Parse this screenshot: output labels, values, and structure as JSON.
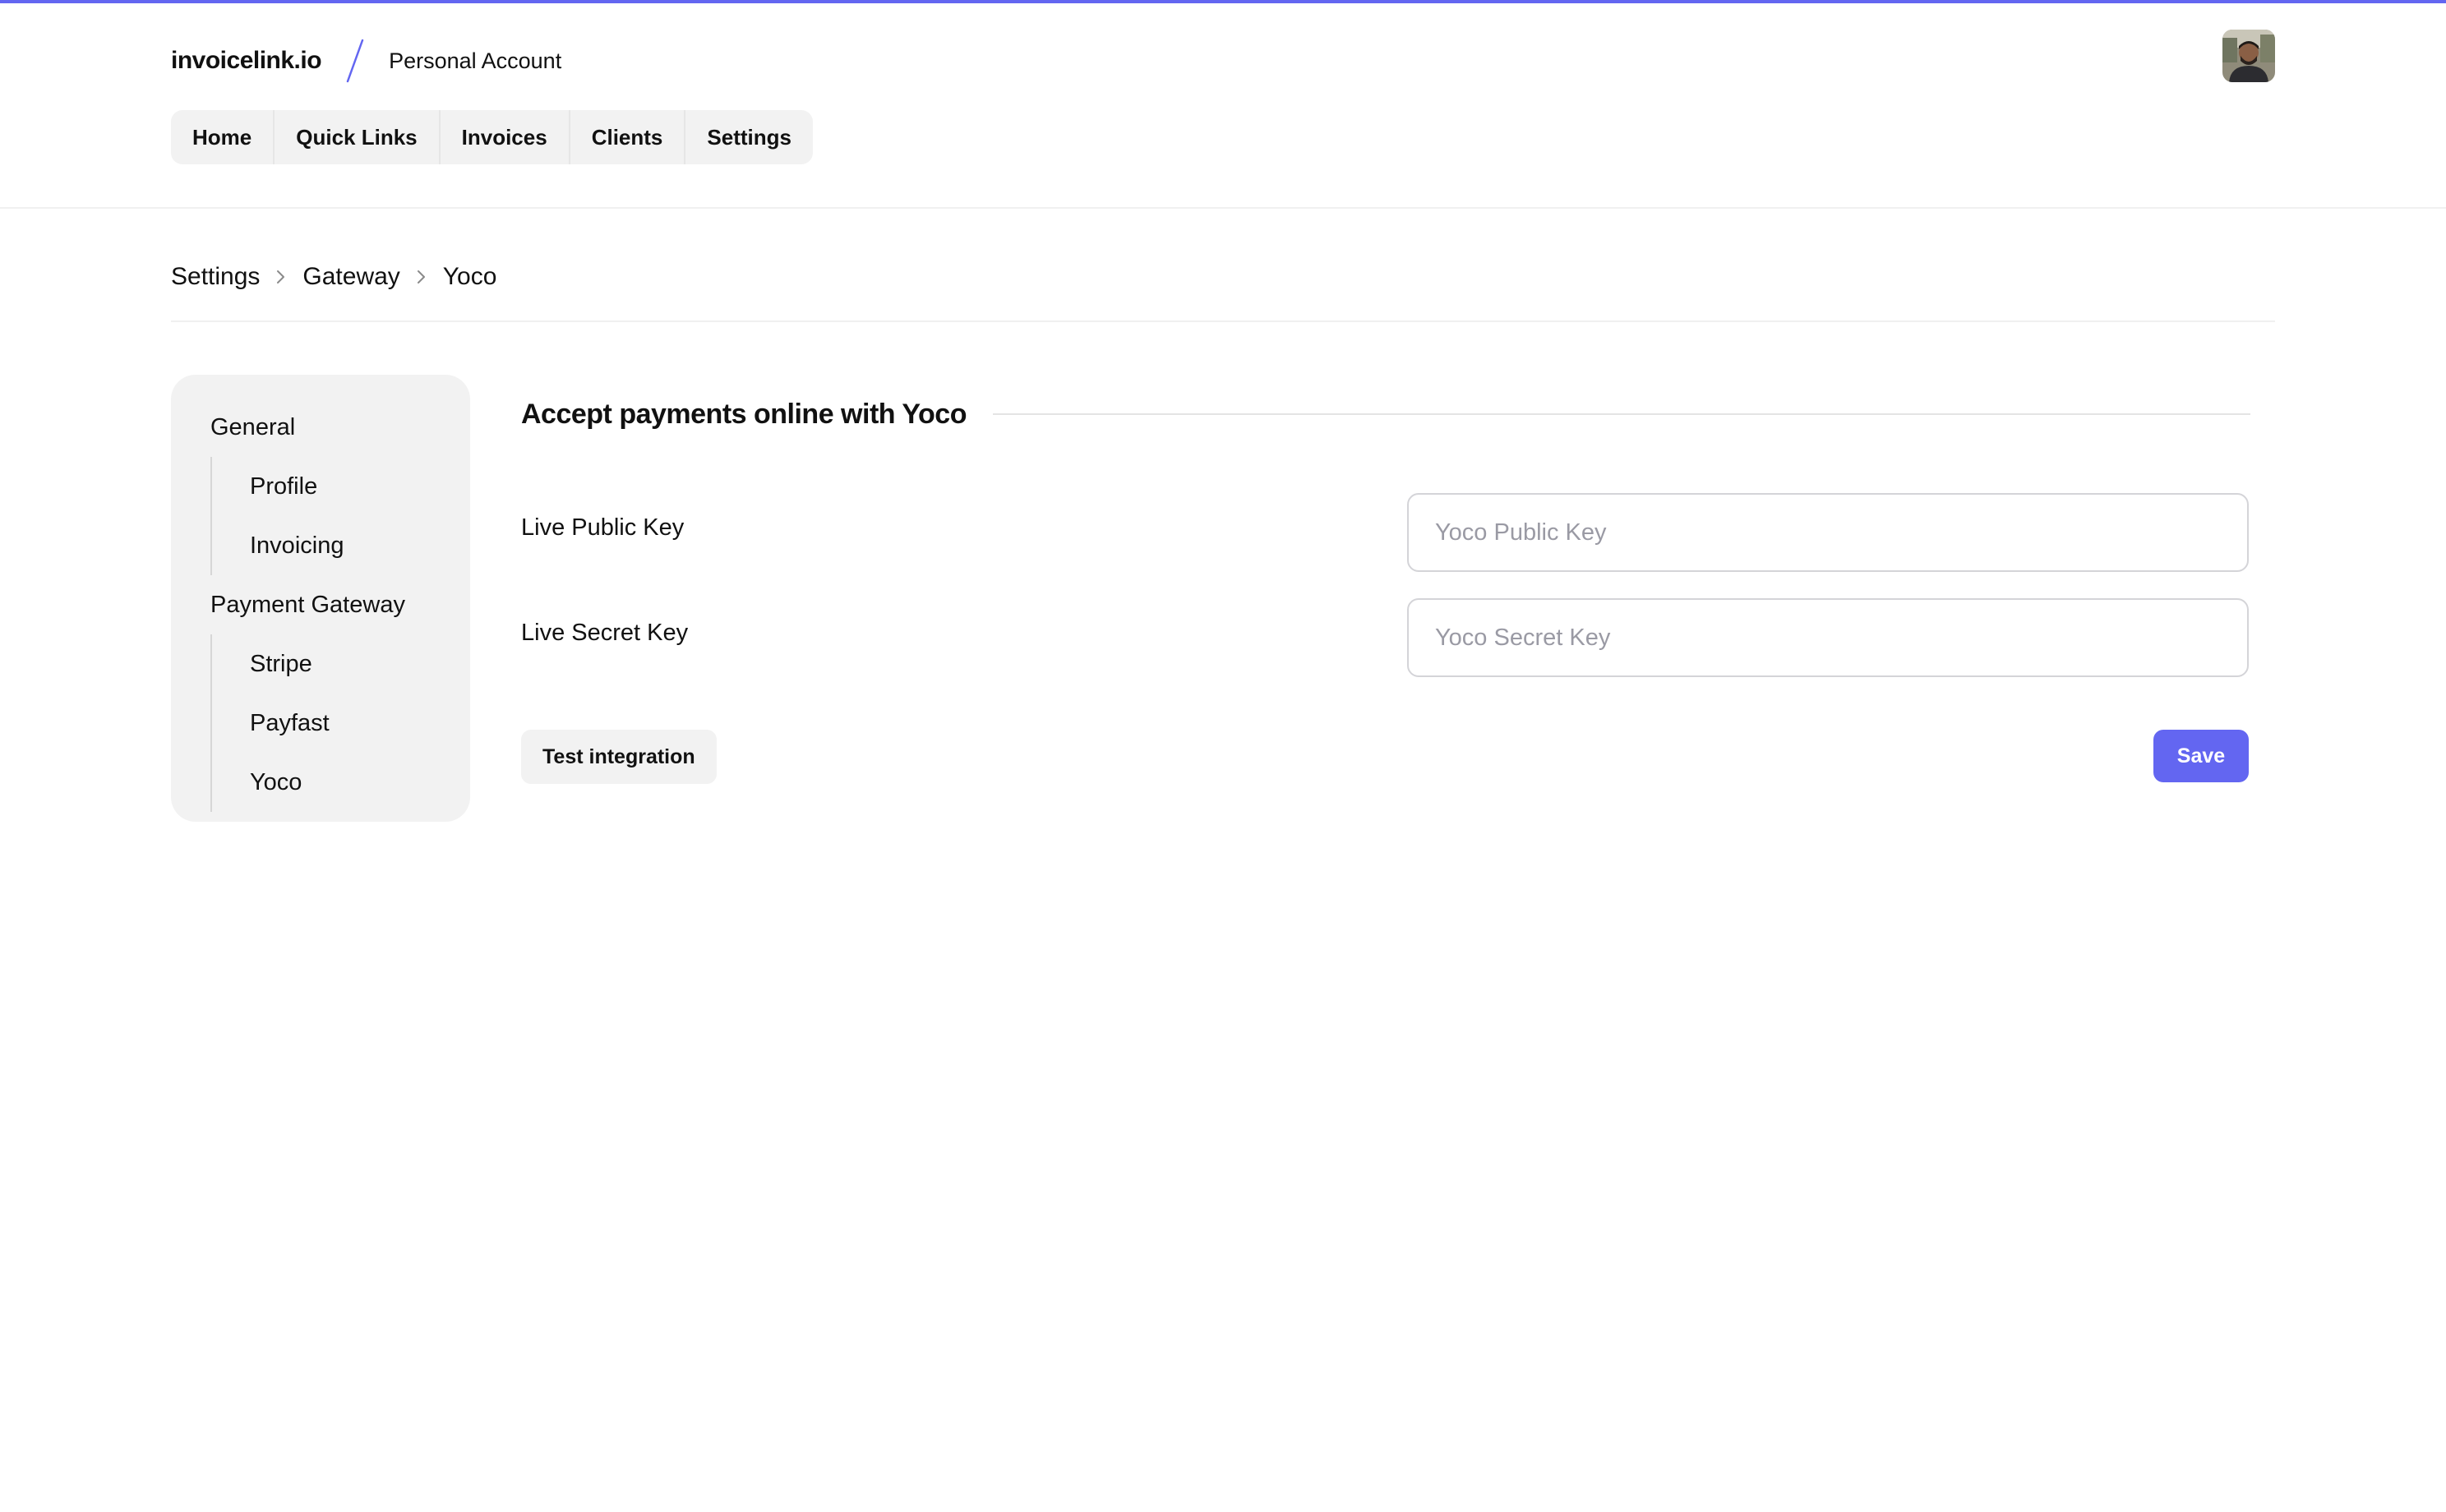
{
  "header": {
    "brand": "invoicelink.io",
    "account": "Personal Account",
    "accent_color": "#6366f1"
  },
  "nav": {
    "items": [
      {
        "label": "Home"
      },
      {
        "label": "Quick Links"
      },
      {
        "label": "Invoices"
      },
      {
        "label": "Clients"
      },
      {
        "label": "Settings"
      }
    ]
  },
  "breadcrumb": {
    "items": [
      "Settings",
      "Gateway",
      "Yoco"
    ]
  },
  "sidenav": {
    "groups": [
      {
        "label": "General",
        "items": [
          "Profile",
          "Invoicing"
        ]
      },
      {
        "label": "Payment Gateway",
        "items": [
          "Stripe",
          "Payfast",
          "Yoco"
        ]
      }
    ]
  },
  "main": {
    "title": "Accept payments online with Yoco",
    "fields": [
      {
        "label": "Live Public Key",
        "value": "",
        "placeholder": "Yoco Public Key"
      },
      {
        "label": "Live Secret Key",
        "value": "",
        "placeholder": "Yoco Secret Key"
      }
    ],
    "test_button": "Test integration",
    "save_button": "Save"
  },
  "icons": {
    "avatar": "user-avatar-photo",
    "breadcrumb_separator": "chevron-right-icon",
    "brand_separator": "slash-icon"
  }
}
